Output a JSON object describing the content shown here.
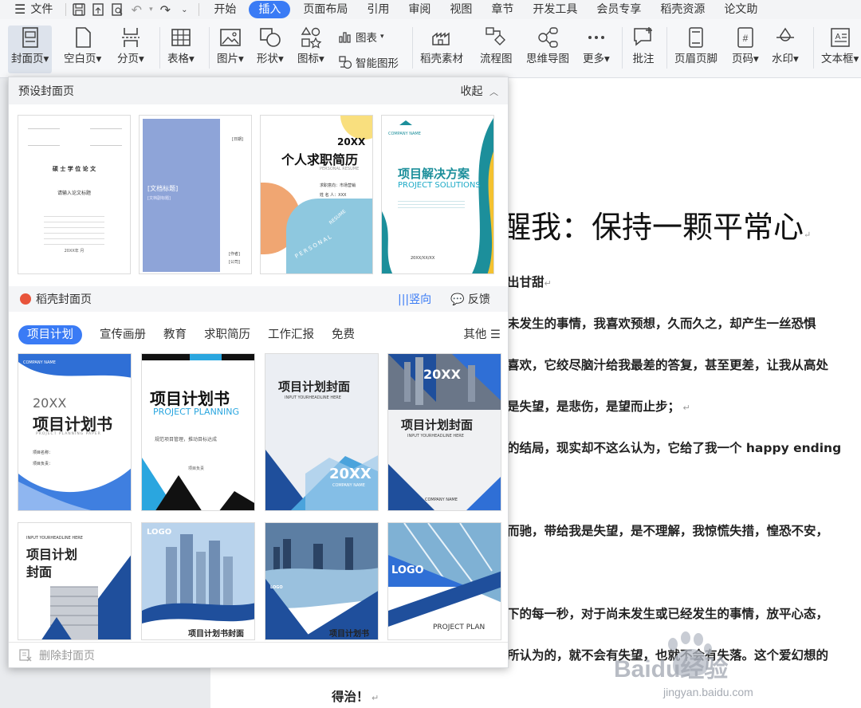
{
  "menubar": {
    "file_label": "文件",
    "tabs": [
      "开始",
      "插入",
      "页面布局",
      "引用",
      "审阅",
      "视图",
      "章节",
      "开发工具",
      "会员专享",
      "稻壳资源",
      "论文助"
    ],
    "active_tab": "插入"
  },
  "ribbon": {
    "cover_page": "封面页",
    "blank_page": "空白页",
    "page_break": "分页",
    "table": "表格",
    "picture": "图片",
    "shape": "形状",
    "icon": "图标",
    "chart": "图表",
    "smart_graphic": "智能图形",
    "docer_material": "稻壳素材",
    "flowchart": "流程图",
    "mindmap": "思维导图",
    "more": "更多",
    "comment": "批注",
    "header_footer": "页眉页脚",
    "page_number": "页码",
    "watermark": "水印",
    "textbox": "文本框"
  },
  "panel": {
    "title": "预设封面页",
    "collapse": "收起",
    "preset": [
      {
        "lines": [
          "硕 士 学 位 论 文",
          "请输入论文标题",
          "20XX年 月"
        ]
      },
      {
        "lines": [
          "[文档标题]",
          "[文档副标题]",
          "[日期]",
          "[作者]",
          "[公司]"
        ]
      },
      {
        "lines": [
          "20XX",
          "个人求职简历",
          "PERSONAL RESUME",
          "求职意向：市场营销",
          "姓  名 人：XXX",
          "RESUME",
          "PERSONAL"
        ]
      },
      {
        "lines": [
          "COMPANY NAME",
          "项目解决方案",
          "PROJECT SOLUTIONS",
          "20XX/XX/XX"
        ]
      }
    ],
    "docer_title": "稻壳封面页",
    "vertical": "竖向",
    "feedback": "反馈",
    "categories": [
      "项目计划",
      "宣传画册",
      "教育",
      "求职简历",
      "工作汇报",
      "免费"
    ],
    "active_category": "项目计划",
    "other": "其他",
    "templates": [
      {
        "lines": [
          "COMPANY NAME",
          "20XX",
          "项目计划书",
          "PROJECT PLANNING PAPER",
          "项目名称：",
          "项目负责："
        ]
      },
      {
        "lines": [
          "项目计划书",
          "PROJECT PLANNING",
          "规范项目管理，推动目标达成",
          "项目负责"
        ]
      },
      {
        "lines": [
          "项目计划封面",
          "INPUT YOURHEADLINE HERE",
          "20XX",
          "COMPANY NAME"
        ]
      },
      {
        "lines": [
          "20XX",
          "项目计划封面",
          "INPUT YOURHEADLINE HERE",
          "COMPANY NAME"
        ]
      },
      {
        "lines": [
          "INPUT YOURHEADLINE HERE",
          "项目计划",
          "封面"
        ]
      },
      {
        "lines": [
          "LOGO",
          "项目计划书封面"
        ]
      },
      {
        "lines": [
          "LOGO",
          "项目计划书"
        ]
      },
      {
        "lines": [
          "LOGO",
          "PROJECT  PLAN"
        ]
      }
    ],
    "delete_cover": "删除封面页"
  },
  "document": {
    "title": "醒我：保持一颗平常心",
    "lines": [
      "出甘甜",
      "未发生的事情，我喜欢预想，久而久之，却产生一丝恐惧",
      "喜欢，它绞尽脑汁给我最差的答复，甚至更差，让我从高处",
      "是失望，是悲伤，是望而止步；",
      "的结局，现实却不这么认为，它给了我一个 happy ending",
      "而驰，带给我是失望，是不理解，我惊慌失措，惶恐不安，",
      "下的每一秒，对于尚未发生或已经发生的事情，放平心态，",
      "所认为的，就不会有失望，也就不会有失落。这个爱幻想的",
      "得治！"
    ]
  },
  "watermark": {
    "brand": "Baidu经验",
    "url": "jingyan.baidu.com"
  },
  "colors": {
    "accent": "#3a7bf5",
    "cover_blue": "#8ea4d8",
    "teal": "#1c8f9b",
    "orange": "#f0a672",
    "navy": "#1f4f9c"
  }
}
